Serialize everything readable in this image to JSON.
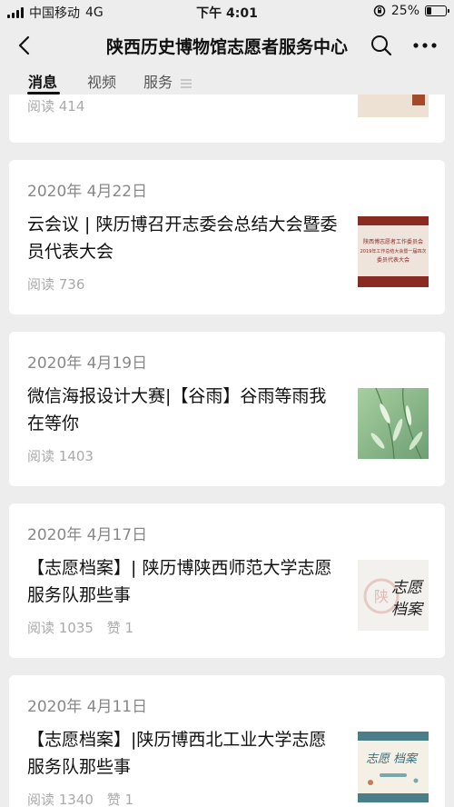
{
  "status_bar": {
    "carrier": "中国移动",
    "network": "4G",
    "time": "下午 4:01",
    "battery": "25%",
    "battery_level": 0.25
  },
  "nav": {
    "title": "陕西历史博物馆志愿者服务中心"
  },
  "tabs": [
    {
      "label": "消息",
      "active": true
    },
    {
      "label": "视频",
      "active": false
    },
    {
      "label": "服务",
      "active": false
    }
  ],
  "partial_card": {
    "read_label": "阅读 414"
  },
  "cards": [
    {
      "date": "2020年 4月22日",
      "title": "云会议 | 陕历博召开志委会总结大会暨委员代表大会",
      "meta": [
        "阅读 736"
      ],
      "thumb": {
        "type": "banner",
        "bg": "#8a2b23",
        "line1": "陕西博志愿者工作委员会",
        "line2": "2019年工作总结大会暨一届四次",
        "line3": "委员代表大会"
      }
    },
    {
      "date": "2020年 4月19日",
      "title": "微信海报设计大赛|【谷雨】谷雨等雨我在等你",
      "meta": [
        "阅读 1403"
      ],
      "thumb": {
        "type": "willow",
        "bg": "#86b58a"
      }
    },
    {
      "date": "2020年 4月17日",
      "title": "【志愿档案】| 陕历博陕西师范大学志愿服务队那些事",
      "meta": [
        "阅读 1035",
        "赞 1"
      ],
      "thumb": {
        "type": "calligraphy",
        "bg": "#f3f1ee",
        "line1": "志愿",
        "line2": "档案",
        "seal": "陕"
      }
    },
    {
      "date": "2020年 4月11日",
      "title": "【志愿档案】|陕历博西北工业大学志愿服务队那些事",
      "meta": [
        "阅读 1340",
        "赞 1"
      ],
      "thumb": {
        "type": "archive",
        "bg": "#f4f0e6",
        "band": "#4a7f89",
        "line1": "志愿",
        "line2": "档案"
      }
    }
  ]
}
